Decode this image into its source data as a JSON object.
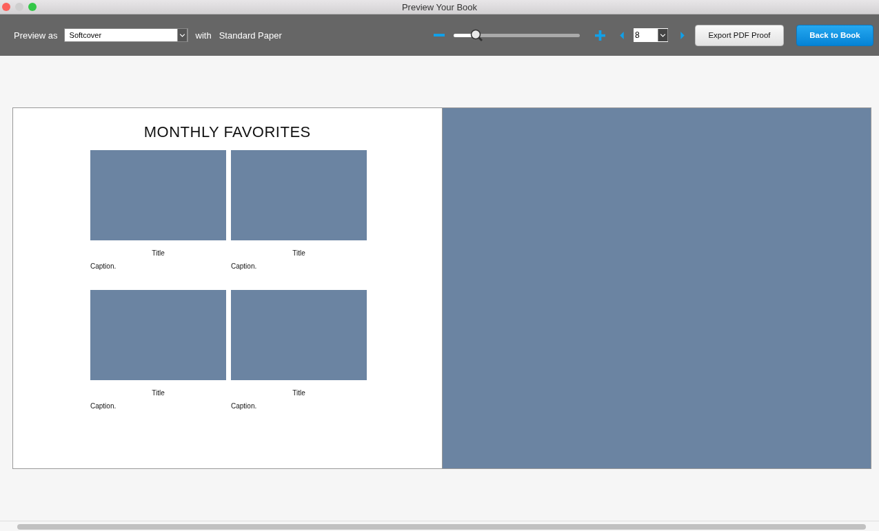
{
  "window": {
    "title": "Preview Your Book"
  },
  "toolbar": {
    "preview_label": "Preview as",
    "cover": {
      "value": "Softcover"
    },
    "with_label": "with",
    "paper": "Standard Paper",
    "zoom": {
      "level": 0.17
    },
    "page": {
      "value": "8"
    },
    "export_button": "Export PDF Proof",
    "back_button": "Back to Book"
  },
  "left_page": {
    "heading": "MONTHLY FAVORITES",
    "photos": [
      {
        "title": "Title",
        "caption": "Caption."
      },
      {
        "title": "Title",
        "caption": "Caption."
      },
      {
        "title": "Title",
        "caption": "Caption."
      },
      {
        "title": "Title",
        "caption": "Caption."
      }
    ]
  },
  "right_page": {
    "kind": "placeholder"
  }
}
